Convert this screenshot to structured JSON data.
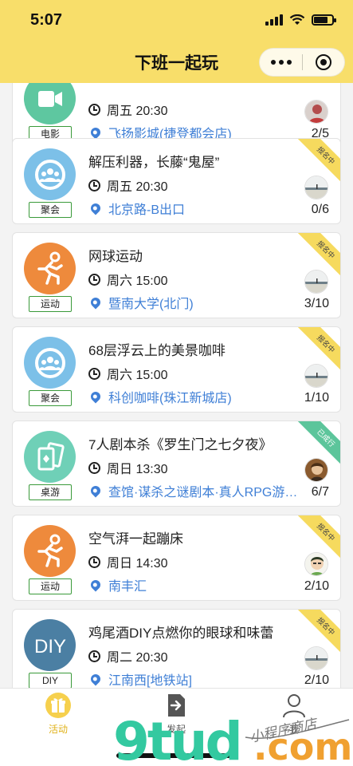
{
  "status": {
    "time": "5:07"
  },
  "nav": {
    "title": "下班一起玩"
  },
  "colors": {
    "header": "#f8de6a",
    "link": "#3f7fd6",
    "enrolling": "#f6da5e",
    "started": "#5cc59b"
  },
  "events": [
    {
      "category": "电影",
      "category_color": "#5ec7a0",
      "icon": "movie-icon",
      "title": "",
      "time": "周五 20:30",
      "location": "飞扬影城(捷登都会店)",
      "count": "2/5",
      "corner": "",
      "avatar": "avatar-red"
    },
    {
      "category": "聚会",
      "category_color": "#7cc0e8",
      "icon": "group-icon",
      "title": "解压利器，长藤“鬼屋”",
      "time": "周五 20:30",
      "location": "北京路-B出口",
      "count": "0/6",
      "corner": "报名中",
      "avatar": "avatar-beach"
    },
    {
      "category": "运动",
      "category_color": "#ee8a3c",
      "icon": "running-icon",
      "title": "网球运动",
      "time": "周六 15:00",
      "location": "暨南大学(北门)",
      "count": "3/10",
      "corner": "报名中",
      "avatar": "avatar-beach"
    },
    {
      "category": "聚会",
      "category_color": "#7cc0e8",
      "icon": "group-icon",
      "title": "68层浮云上的美景咖啡",
      "time": "周六 15:00",
      "location": "科创咖啡(珠江新城店)",
      "count": "1/10",
      "corner": "报名中",
      "avatar": "avatar-beach"
    },
    {
      "category": "桌游",
      "category_color": "#6fd0b7",
      "icon": "cards-icon",
      "title": "7人剧本杀《罗生门之七夕夜》",
      "time": "周日 13:30",
      "location": "查馆·谋杀之谜剧本·真人RPG游戏馆",
      "count": "6/7",
      "corner": "已成行",
      "avatar": "avatar-brown"
    },
    {
      "category": "运动",
      "category_color": "#ee8a3c",
      "icon": "running-icon",
      "title": "空气湃一起蹦床",
      "time": "周日 14:30",
      "location": "南丰汇",
      "count": "2/10",
      "corner": "报名中",
      "avatar": "avatar-face"
    },
    {
      "category": "DIY",
      "category_color": "#4b7fa3",
      "icon": "diy-icon",
      "title": "鸡尾酒DIY点燃你的眼球和味蕾",
      "time": "周二 20:30",
      "location": "江南西[地铁站]",
      "count": "2/10",
      "corner": "报名中",
      "avatar": "avatar-beach"
    }
  ],
  "tabs": [
    {
      "label": "活动",
      "icon": "gift-icon",
      "active": true
    },
    {
      "label": "发起",
      "icon": "post-icon",
      "active": false
    },
    {
      "label": "我",
      "icon": "user-icon",
      "active": false
    }
  ],
  "watermark": {
    "logo": "9tud.com",
    "script": "小程序商店"
  }
}
